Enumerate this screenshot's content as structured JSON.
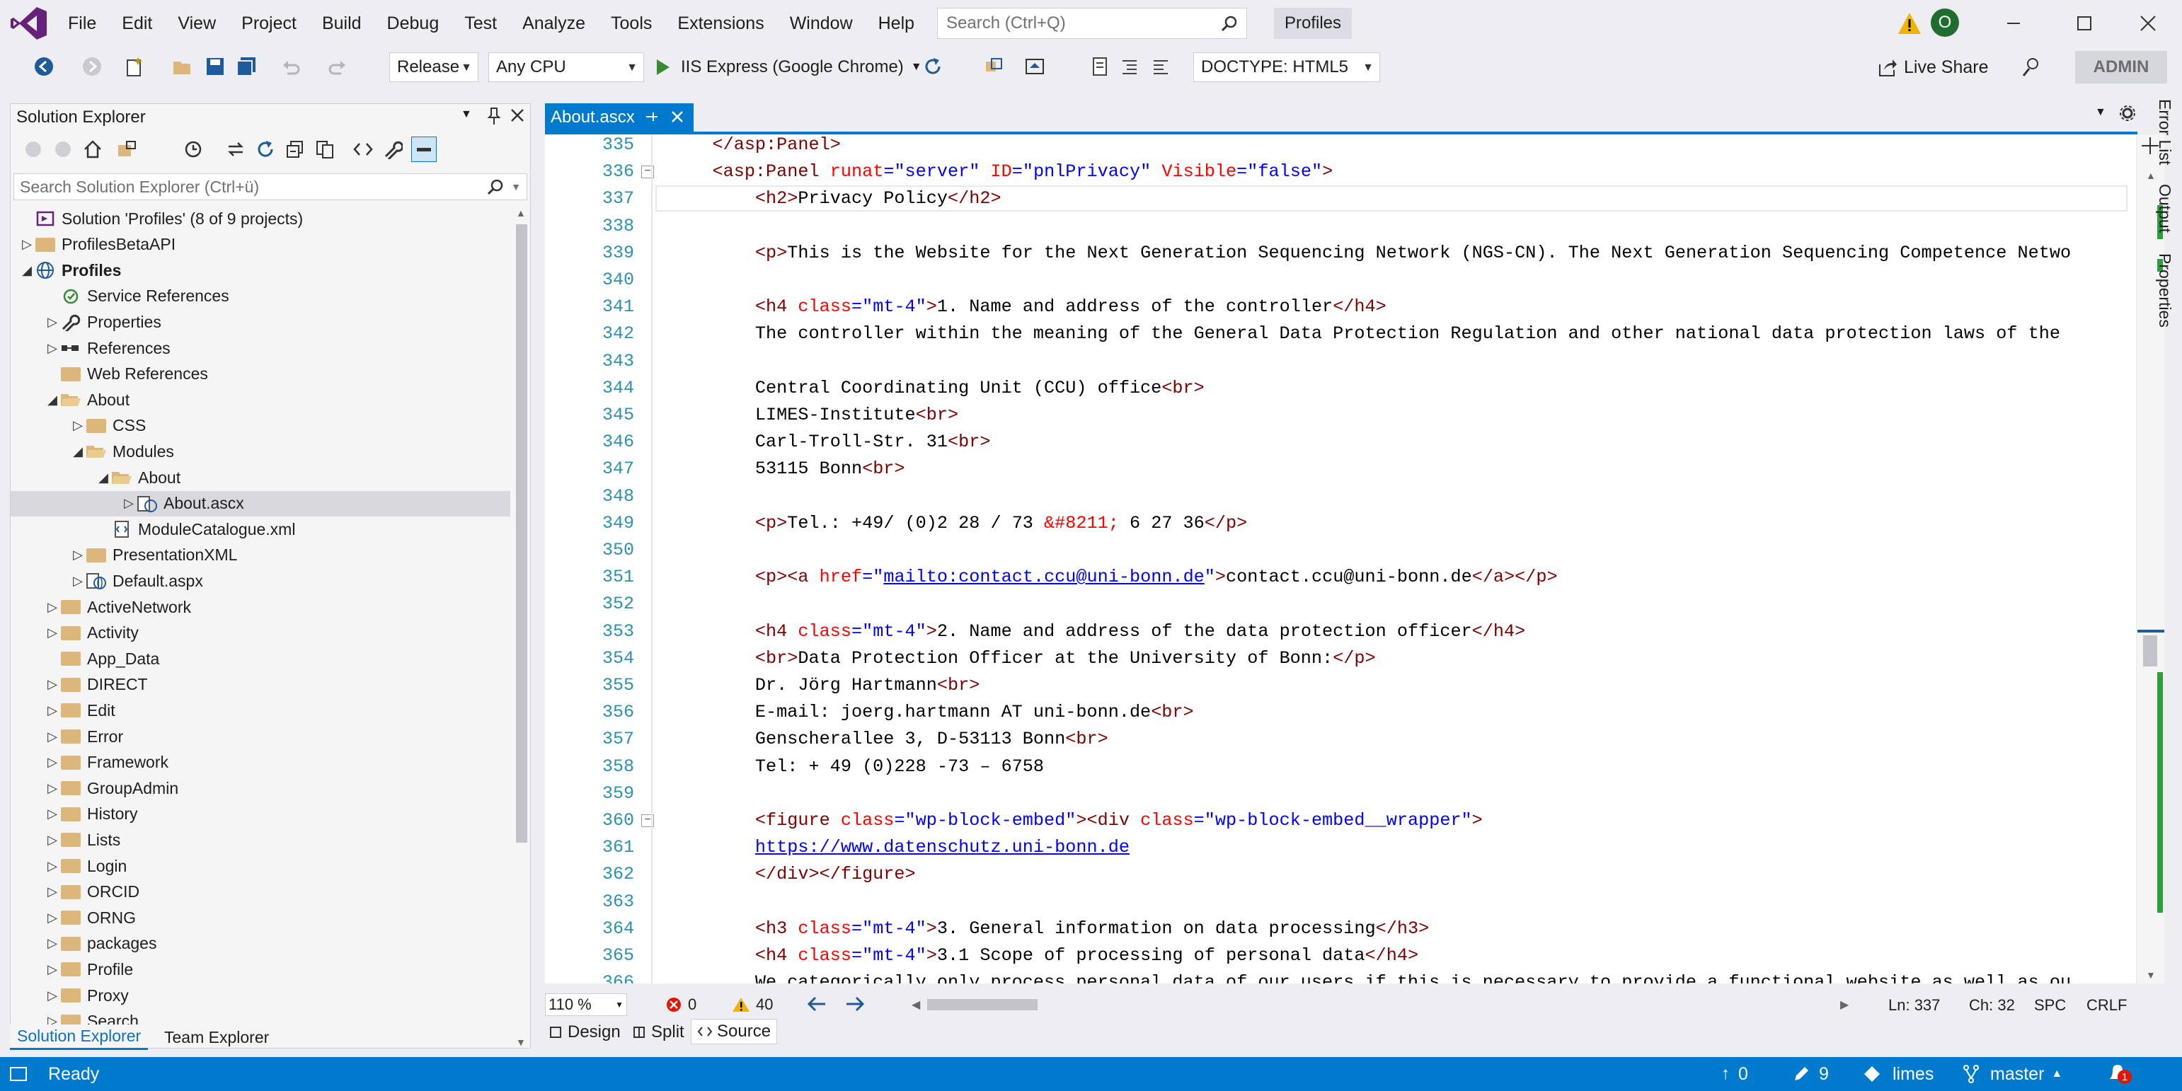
{
  "menubar": {
    "items": [
      "File",
      "Edit",
      "View",
      "Project",
      "Build",
      "Debug",
      "Test",
      "Analyze",
      "Tools",
      "Extensions",
      "Window",
      "Help"
    ],
    "search_placeholder": "Search (Ctrl+Q)",
    "solution_name": "Profiles",
    "avatar_initial": "O"
  },
  "toolbar": {
    "configuration": "Release",
    "platform": "Any CPU",
    "run_target": "IIS Express (Google Chrome)",
    "doctype": "DOCTYPE: HTML5",
    "live_share": "Live Share",
    "admin": "ADMIN"
  },
  "solution_explorer": {
    "title": "Solution Explorer",
    "search_placeholder": "Search Solution Explorer (Ctrl+ü)",
    "items": [
      {
        "label": "Solution 'Profiles' (8 of 9 projects)",
        "level": 0,
        "expander": "",
        "icon": "solution",
        "bold": false
      },
      {
        "label": "ProfilesBetaAPI",
        "level": 0,
        "expander": "collapsed",
        "icon": "folder",
        "bold": false
      },
      {
        "label": "Profiles",
        "level": 0,
        "expander": "expanded",
        "icon": "web-project",
        "bold": true
      },
      {
        "label": "Service References",
        "level": 1,
        "expander": "",
        "icon": "service",
        "bold": false
      },
      {
        "label": "Properties",
        "level": 1,
        "expander": "collapsed",
        "icon": "wrench",
        "bold": false
      },
      {
        "label": "References",
        "level": 1,
        "expander": "collapsed",
        "icon": "references",
        "bold": false
      },
      {
        "label": "Web References",
        "level": 1,
        "expander": "",
        "icon": "folder",
        "bold": false
      },
      {
        "label": "About",
        "level": 1,
        "expander": "expanded",
        "icon": "folder-open",
        "bold": false
      },
      {
        "label": "CSS",
        "level": 2,
        "expander": "collapsed",
        "icon": "folder",
        "bold": false
      },
      {
        "label": "Modules",
        "level": 2,
        "expander": "expanded",
        "icon": "folder-open",
        "bold": false
      },
      {
        "label": "About",
        "level": 3,
        "expander": "expanded",
        "icon": "folder-open",
        "bold": false
      },
      {
        "label": "About.ascx",
        "level": 4,
        "expander": "collapsed",
        "icon": "ascx-file",
        "bold": false,
        "selected": true
      },
      {
        "label": "ModuleCatalogue.xml",
        "level": 3,
        "expander": "",
        "icon": "xml-file",
        "bold": false
      },
      {
        "label": "PresentationXML",
        "level": 2,
        "expander": "collapsed",
        "icon": "folder",
        "bold": false
      },
      {
        "label": "Default.aspx",
        "level": 2,
        "expander": "collapsed",
        "icon": "aspx-file",
        "bold": false
      },
      {
        "label": "ActiveNetwork",
        "level": 1,
        "expander": "collapsed",
        "icon": "folder",
        "bold": false
      },
      {
        "label": "Activity",
        "level": 1,
        "expander": "collapsed",
        "icon": "folder",
        "bold": false
      },
      {
        "label": "App_Data",
        "level": 1,
        "expander": "",
        "icon": "folder",
        "bold": false
      },
      {
        "label": "DIRECT",
        "level": 1,
        "expander": "collapsed",
        "icon": "folder",
        "bold": false
      },
      {
        "label": "Edit",
        "level": 1,
        "expander": "collapsed",
        "icon": "folder",
        "bold": false
      },
      {
        "label": "Error",
        "level": 1,
        "expander": "collapsed",
        "icon": "folder",
        "bold": false
      },
      {
        "label": "Framework",
        "level": 1,
        "expander": "collapsed",
        "icon": "folder",
        "bold": false
      },
      {
        "label": "GroupAdmin",
        "level": 1,
        "expander": "collapsed",
        "icon": "folder",
        "bold": false
      },
      {
        "label": "History",
        "level": 1,
        "expander": "collapsed",
        "icon": "folder",
        "bold": false
      },
      {
        "label": "Lists",
        "level": 1,
        "expander": "collapsed",
        "icon": "folder",
        "bold": false
      },
      {
        "label": "Login",
        "level": 1,
        "expander": "collapsed",
        "icon": "folder",
        "bold": false
      },
      {
        "label": "ORCID",
        "level": 1,
        "expander": "collapsed",
        "icon": "folder",
        "bold": false
      },
      {
        "label": "ORNG",
        "level": 1,
        "expander": "collapsed",
        "icon": "folder",
        "bold": false
      },
      {
        "label": "packages",
        "level": 1,
        "expander": "collapsed",
        "icon": "folder",
        "bold": false
      },
      {
        "label": "Profile",
        "level": 1,
        "expander": "collapsed",
        "icon": "folder",
        "bold": false
      },
      {
        "label": "Proxy",
        "level": 1,
        "expander": "collapsed",
        "icon": "folder",
        "bold": false
      },
      {
        "label": "Search",
        "level": 1,
        "expander": "collapsed",
        "icon": "folder",
        "bold": false
      }
    ],
    "bottom_tabs": [
      "Solution Explorer",
      "Team Explorer"
    ]
  },
  "editor": {
    "tab_title": "About.ascx",
    "right_tabs": [
      "Error List",
      "Output",
      "Properties"
    ],
    "lines": [
      {
        "n": "335",
        "tokens": [
          [
            "p",
            "    "
          ],
          [
            "t",
            "</asp:Panel>"
          ]
        ]
      },
      {
        "n": "336",
        "fold": "−",
        "tokens": [
          [
            "p",
            "    "
          ],
          [
            "t",
            "<asp:Panel "
          ],
          [
            "a",
            "runat"
          ],
          [
            "b",
            "="
          ],
          [
            "v",
            "\"server\" "
          ],
          [
            "a",
            "ID"
          ],
          [
            "b",
            "="
          ],
          [
            "v",
            "\"pnlPrivacy\" "
          ],
          [
            "a",
            "Visible"
          ],
          [
            "b",
            "="
          ],
          [
            "v",
            "\"false\""
          ],
          [
            "t",
            ">"
          ]
        ]
      },
      {
        "n": "337",
        "current": true,
        "tokens": [
          [
            "p",
            "        "
          ],
          [
            "t",
            "<h2>"
          ],
          [
            "p",
            "Privacy Policy"
          ],
          [
            "t",
            "</h2>"
          ]
        ]
      },
      {
        "n": "338",
        "tokens": []
      },
      {
        "n": "339",
        "tokens": [
          [
            "p",
            "        "
          ],
          [
            "t",
            "<p>"
          ],
          [
            "p",
            "This is the Website for the Next Generation Sequencing Network (NGS-CN). The Next Generation Sequencing Competence Netwo"
          ]
        ]
      },
      {
        "n": "340",
        "tokens": []
      },
      {
        "n": "341",
        "tokens": [
          [
            "p",
            "        "
          ],
          [
            "t",
            "<h4 "
          ],
          [
            "a",
            "class"
          ],
          [
            "b",
            "="
          ],
          [
            "v",
            "\"mt-4\""
          ],
          [
            "t",
            ">"
          ],
          [
            "p",
            "1. Name and address of the controller"
          ],
          [
            "t",
            "</h4>"
          ]
        ]
      },
      {
        "n": "342",
        "tokens": [
          [
            "p",
            "        The controller within the meaning of the General Data Protection Regulation and other national data protection laws of the"
          ]
        ]
      },
      {
        "n": "343",
        "tokens": []
      },
      {
        "n": "344",
        "tokens": [
          [
            "p",
            "        Central Coordinating Unit (CCU) office"
          ],
          [
            "t",
            "<br>"
          ]
        ]
      },
      {
        "n": "345",
        "tokens": [
          [
            "p",
            "        LIMES-Institute"
          ],
          [
            "t",
            "<br>"
          ]
        ]
      },
      {
        "n": "346",
        "tokens": [
          [
            "p",
            "        Carl-Troll-Str. 31"
          ],
          [
            "t",
            "<br>"
          ]
        ]
      },
      {
        "n": "347",
        "tokens": [
          [
            "p",
            "        53115 Bonn"
          ],
          [
            "t",
            "<br>"
          ]
        ]
      },
      {
        "n": "348",
        "tokens": []
      },
      {
        "n": "349",
        "tokens": [
          [
            "p",
            "        "
          ],
          [
            "t",
            "<p>"
          ],
          [
            "p",
            "Tel.: +49/ (0)2 28 / 73 "
          ],
          [
            "a",
            "&#8211;"
          ],
          [
            "p",
            " 6 27 36"
          ],
          [
            "t",
            "</p>"
          ]
        ]
      },
      {
        "n": "350",
        "tokens": []
      },
      {
        "n": "351",
        "tokens": [
          [
            "p",
            "        "
          ],
          [
            "t",
            "<p><a "
          ],
          [
            "a",
            "href"
          ],
          [
            "b",
            "="
          ],
          [
            "v",
            "\""
          ],
          [
            "u",
            "mailto:contact.ccu@uni-bonn.de"
          ],
          [
            "v",
            "\""
          ],
          [
            "t",
            ">"
          ],
          [
            "p",
            "contact.ccu@uni-bonn.de"
          ],
          [
            "t",
            "</a></p>"
          ]
        ]
      },
      {
        "n": "352",
        "tokens": []
      },
      {
        "n": "353",
        "tokens": [
          [
            "p",
            "        "
          ],
          [
            "t",
            "<h4 "
          ],
          [
            "a",
            "class"
          ],
          [
            "b",
            "="
          ],
          [
            "v",
            "\"mt-4\""
          ],
          [
            "t",
            ">"
          ],
          [
            "p",
            "2. Name and address of the data protection officer"
          ],
          [
            "t",
            "</h4>"
          ]
        ]
      },
      {
        "n": "354",
        "tokens": [
          [
            "p",
            "        "
          ],
          [
            "t",
            "<br>"
          ],
          [
            "p",
            "Data Protection Officer at the University of Bonn:"
          ],
          [
            "t",
            "</p>"
          ]
        ]
      },
      {
        "n": "355",
        "tokens": [
          [
            "p",
            "        Dr. Jörg Hartmann"
          ],
          [
            "t",
            "<br>"
          ]
        ]
      },
      {
        "n": "356",
        "tokens": [
          [
            "p",
            "        E-mail: joerg.hartmann AT uni-bonn.de"
          ],
          [
            "t",
            "<br>"
          ]
        ]
      },
      {
        "n": "357",
        "tokens": [
          [
            "p",
            "        Genscherallee 3, D-53113 Bonn"
          ],
          [
            "t",
            "<br>"
          ]
        ]
      },
      {
        "n": "358",
        "tokens": [
          [
            "p",
            "        Tel: + 49 (0)228 -73 – 6758"
          ]
        ]
      },
      {
        "n": "359",
        "tokens": []
      },
      {
        "n": "360",
        "fold": "−",
        "tokens": [
          [
            "p",
            "        "
          ],
          [
            "t",
            "<figure "
          ],
          [
            "a",
            "class"
          ],
          [
            "b",
            "="
          ],
          [
            "v",
            "\"wp-block-embed\""
          ],
          [
            "t",
            "><div "
          ],
          [
            "a",
            "class"
          ],
          [
            "b",
            "="
          ],
          [
            "v",
            "\"wp-block-embed__wrapper\""
          ],
          [
            "t",
            ">"
          ]
        ]
      },
      {
        "n": "361",
        "tokens": [
          [
            "p",
            "        "
          ],
          [
            "u",
            "https://www.datenschutz.uni-bonn.de"
          ]
        ]
      },
      {
        "n": "362",
        "tokens": [
          [
            "p",
            "        "
          ],
          [
            "t",
            "</div></figure>"
          ]
        ]
      },
      {
        "n": "363",
        "tokens": []
      },
      {
        "n": "364",
        "tokens": [
          [
            "p",
            "        "
          ],
          [
            "t",
            "<h3 "
          ],
          [
            "a",
            "class"
          ],
          [
            "b",
            "="
          ],
          [
            "v",
            "\"mt-4\""
          ],
          [
            "t",
            ">"
          ],
          [
            "p",
            "3. General information on data processing"
          ],
          [
            "t",
            "</h3>"
          ]
        ]
      },
      {
        "n": "365",
        "tokens": [
          [
            "p",
            "        "
          ],
          [
            "t",
            "<h4 "
          ],
          [
            "a",
            "class"
          ],
          [
            "b",
            "="
          ],
          [
            "v",
            "\"mt-4\""
          ],
          [
            "t",
            ">"
          ],
          [
            "p",
            "3.1 Scope of processing of personal data"
          ],
          [
            "t",
            "</h4>"
          ]
        ]
      },
      {
        "n": "366",
        "tokens": [
          [
            "p",
            "        We categorically only process personal data of our users if this is necessary to provide a functional website as well as ou"
          ]
        ]
      },
      {
        "n": "367",
        "tokens": []
      }
    ],
    "status": {
      "zoom": "110 %",
      "errors": "0",
      "warnings": "40",
      "line": "Ln: 337",
      "col": "Ch: 32",
      "spc": "SPC",
      "crlf": "CRLF"
    },
    "view_tabs": [
      "Design",
      "Split",
      "Source"
    ],
    "active_view": "Source"
  },
  "statusbar": {
    "state": "Ready",
    "pending_up": "0",
    "changes": "9",
    "repo": "limes",
    "branch": "master",
    "notifications": "1"
  },
  "colors": {
    "accent": "#007acc",
    "tag": "#800000",
    "attr": "#ff0000",
    "value": "#0000ff",
    "line_number": "#2b91af"
  }
}
